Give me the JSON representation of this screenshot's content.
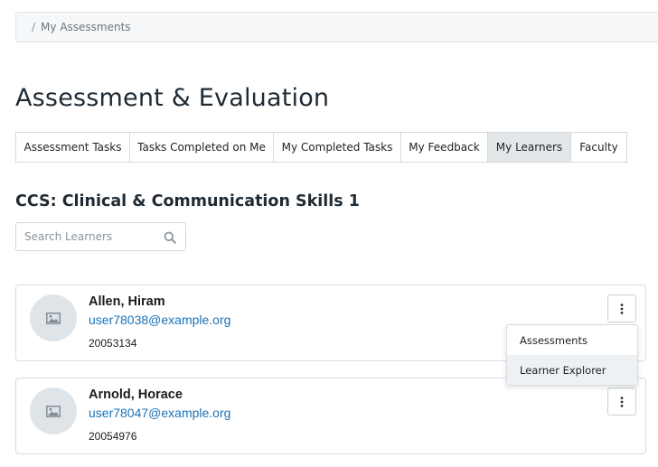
{
  "breadcrumb": {
    "separator": "/",
    "current": "My Assessments"
  },
  "page_title": "Assessment & Evaluation",
  "tabs": [
    {
      "label": "Assessment Tasks",
      "active": false
    },
    {
      "label": "Tasks Completed on Me",
      "active": false
    },
    {
      "label": "My Completed Tasks",
      "active": false
    },
    {
      "label": "My Feedback",
      "active": false
    },
    {
      "label": "My Learners",
      "active": true
    },
    {
      "label": "Faculty",
      "active": false
    }
  ],
  "course_title": "CCS: Clinical & Communication Skills 1",
  "search": {
    "placeholder": "Search Learners",
    "value": ""
  },
  "learners": [
    {
      "name": "Allen, Hiram",
      "email": "user78038@example.org",
      "id": "20053134"
    },
    {
      "name": "Arnold, Horace",
      "email": "user78047@example.org",
      "id": "20054976"
    }
  ],
  "dropdown": {
    "items": [
      "Assessments",
      "Learner Explorer"
    ],
    "highlighted_index": 1
  },
  "colors": {
    "link": "#1a73b8",
    "active_tab": "#e3e7ea",
    "avatar": "#dfe4e8"
  },
  "icons": {
    "search": "search-icon",
    "avatar": "image-placeholder-icon",
    "menu": "kebab-vertical-icon"
  }
}
